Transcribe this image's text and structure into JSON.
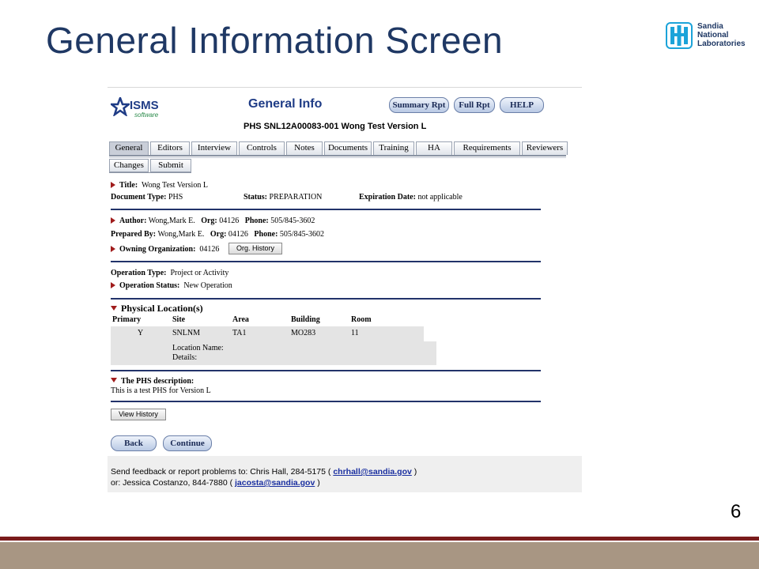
{
  "slide": {
    "title": "General Information Screen",
    "number": "6",
    "logo_lines": [
      "Sandia",
      "National",
      "Laboratories"
    ]
  },
  "app": {
    "logo_text": "ISMS",
    "logo_sub": "software",
    "title": "General Info",
    "doc_id": "PHS  SNL12A00083-001  Wong Test Version L",
    "header_buttons": [
      "Summary Rpt",
      "Full Rpt",
      "HELP"
    ],
    "tabs": [
      "General",
      "Editors",
      "Interview",
      "Controls",
      "Notes",
      "Documents",
      "Training",
      "HA",
      "Requirements",
      "Reviewers"
    ],
    "active_tab": "General",
    "subtabs": [
      "Changes",
      "Submit"
    ]
  },
  "general": {
    "title_label": "Title:",
    "title_value": "Wong Test Version L",
    "doctype_label": "Document Type:",
    "doctype_value": "PHS",
    "status_label": "Status:",
    "status_value": "PREPARATION",
    "expiration_label": "Expiration Date:",
    "expiration_value": "not applicable",
    "author_label": "Author:",
    "author_value": "Wong,Mark E.",
    "org_label": "Org:",
    "author_org": "04126",
    "phone_label": "Phone:",
    "author_phone": "505/845-3602",
    "prepared_label": "Prepared By:",
    "prepared_value": "Wong,Mark E.",
    "prepared_org": "04126",
    "prepared_phone": "505/845-3602",
    "owning_label": "Owning Organization:",
    "owning_value": "04126",
    "org_history_button": "Org. History",
    "optype_label": "Operation Type:",
    "optype_value": "Project or Activity",
    "opstatus_label": "Operation Status:",
    "opstatus_value": "New Operation"
  },
  "location": {
    "heading": "Physical Location(s)",
    "headers": [
      "Primary",
      "Site",
      "Area",
      "Building",
      "Room"
    ],
    "row": [
      "Y",
      "SNLNM",
      "TA1",
      "MO283",
      "11"
    ],
    "location_name_label": "Location Name:",
    "details_label": "Details:"
  },
  "description": {
    "heading": "The PHS description:",
    "text": "This is a test PHS for Version L"
  },
  "actions": {
    "view_history": "View History",
    "back": "Back",
    "continue": "Continue"
  },
  "footer": {
    "line1_prefix": "Send feedback or report problems to: Chris Hall,  284-5175 (",
    "email1": "chrhall@sandia.gov",
    "line1_suffix": ")",
    "line2_prefix": "or: Jessica Costanzo,  844-7880 (",
    "email2": "jacosta@sandia.gov",
    "line2_suffix": ")"
  },
  "colors": {
    "title_blue": "#1f3864",
    "link_blue": "#1a2fa0",
    "accent_red": "#a01c1c",
    "bar_red": "#7a1c1c",
    "bar_tan": "#a89683"
  }
}
